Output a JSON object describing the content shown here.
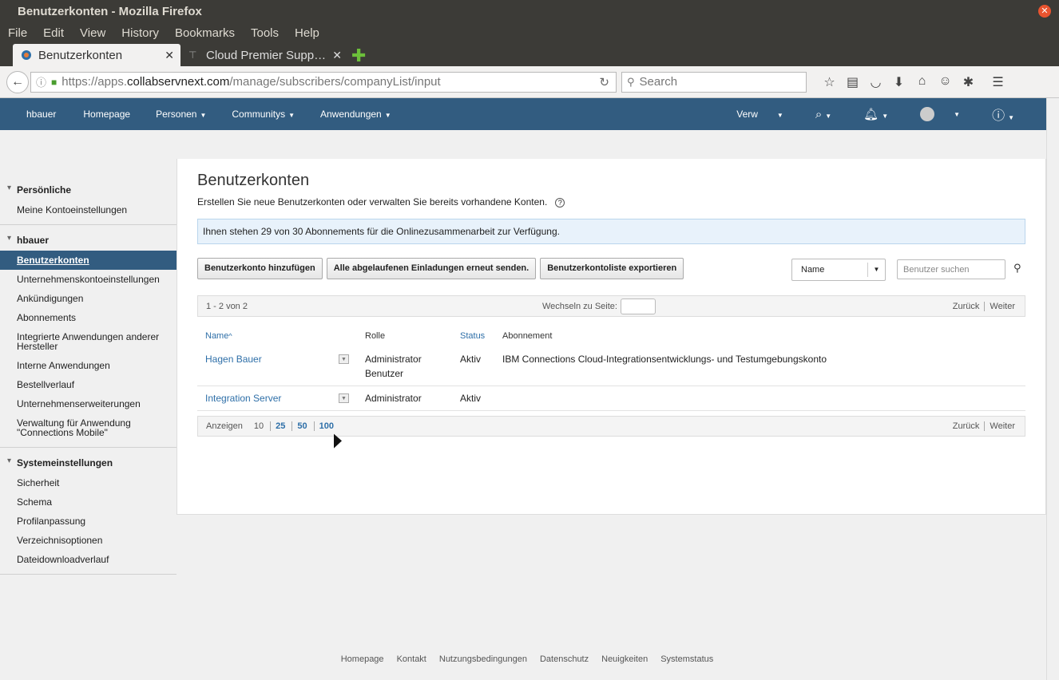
{
  "window": {
    "title": "Benutzerkonten - Mozilla Firefox"
  },
  "menu": [
    "File",
    "Edit",
    "View",
    "History",
    "Bookmarks",
    "Tools",
    "Help"
  ],
  "tabs": [
    {
      "label": "Benutzerkonten",
      "active": true
    },
    {
      "label": "Cloud Premier Supp…",
      "active": false
    }
  ],
  "url": {
    "prefix": "https://apps.",
    "host": "collabservnext.com",
    "path": "/manage/subscribers/companyList/input"
  },
  "search_placeholder": "Search",
  "appnav": {
    "user": "hbauer",
    "homepage": "Homepage",
    "personen": "Personen",
    "communitys": "Communitys",
    "anwendungen": "Anwendungen",
    "verw": "Verw"
  },
  "sidebar": {
    "groups": [
      {
        "title": "Persönliche",
        "items": [
          "Meine Kontoeinstellungen"
        ]
      },
      {
        "title": "hbauer",
        "items": [
          "Benutzerkonten",
          "Unternehmenskontoeinstellungen",
          "Ankündigungen",
          "Abonnements",
          "Integrierte Anwendungen anderer Hersteller",
          "Interne Anwendungen",
          "Bestellverlauf",
          "Unternehmenserweiterungen",
          "Verwaltung für Anwendung \"Connections Mobile\""
        ]
      },
      {
        "title": "Systemeinstellungen",
        "items": [
          "Sicherheit",
          "Schema",
          "Profilanpassung",
          "Verzeichnisoptionen",
          "Dateidownloadverlauf"
        ]
      }
    ]
  },
  "main": {
    "title": "Benutzerkonten",
    "description": "Erstellen Sie neue Benutzerkonten oder verwalten Sie bereits vorhandene Konten.",
    "info": "Ihnen stehen 29 von 30 Abonnements für die Onlinezusammenarbeit zur Verfügung.",
    "buttons": {
      "add": "Benutzerkonto hinzufügen",
      "resend": "Alle abgelaufenen Einladungen erneut senden.",
      "export": "Benutzerkontoliste exportieren"
    },
    "sort_value": "Name",
    "user_search_placeholder": "Benutzer suchen",
    "pager": {
      "range": "1 - 2 von 2",
      "goto": "Wechseln zu Seite:",
      "back": "Zurück",
      "next": "Weiter",
      "show": "Anzeigen",
      "sizes": [
        "10",
        "25",
        "50",
        "100"
      ]
    },
    "table": {
      "headers": {
        "name": "Name",
        "role": "Rolle",
        "status": "Status",
        "subscription": "Abonnement"
      },
      "rows": [
        {
          "name": "Hagen Bauer",
          "role1": "Administrator",
          "role2": "Benutzer",
          "status": "Aktiv",
          "subscription": "IBM Connections Cloud-Integrationsentwicklungs- und Testumgebungskonto"
        },
        {
          "name": "Integration Server",
          "role1": "Administrator",
          "role2": "",
          "status": "Aktiv",
          "subscription": ""
        }
      ]
    }
  },
  "footer": [
    "Homepage",
    "Kontakt",
    "Nutzungsbedingungen",
    "Datenschutz",
    "Neuigkeiten",
    "Systemstatus"
  ]
}
